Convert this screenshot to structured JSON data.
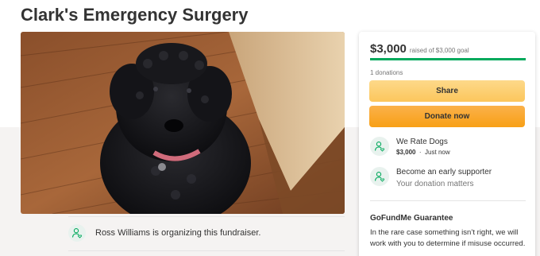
{
  "page": {
    "title": "Clark's Emergency Surgery",
    "organizer_text": "Ross Williams is organizing this fundraiser."
  },
  "card": {
    "amount": "$3,000",
    "goal_text": "raised of $3,000 goal",
    "progress_fraction": 1.0,
    "donations_text": "1 donations",
    "share_label": "Share",
    "donate_label": "Donate now",
    "donors": [
      {
        "name": "We Rate Dogs",
        "amount": "$3,000",
        "separator": "·",
        "time": "Just now"
      },
      {
        "name": "Become an early supporter",
        "subtitle": "Your donation matters"
      }
    ],
    "guarantee_title": "GoFundMe Guarantee",
    "guarantee_text": "In the rare case something isn’t right, we will work with you to determine if misuse occurred."
  },
  "colors": {
    "brand_green": "#02a95c",
    "share_button": "#fcc65c",
    "donate_button": "#f8a016",
    "text": "#333333",
    "muted_text": "#767676"
  },
  "icons": {
    "organizer": "user-heart-icon",
    "donor": "user-heart-icon"
  }
}
